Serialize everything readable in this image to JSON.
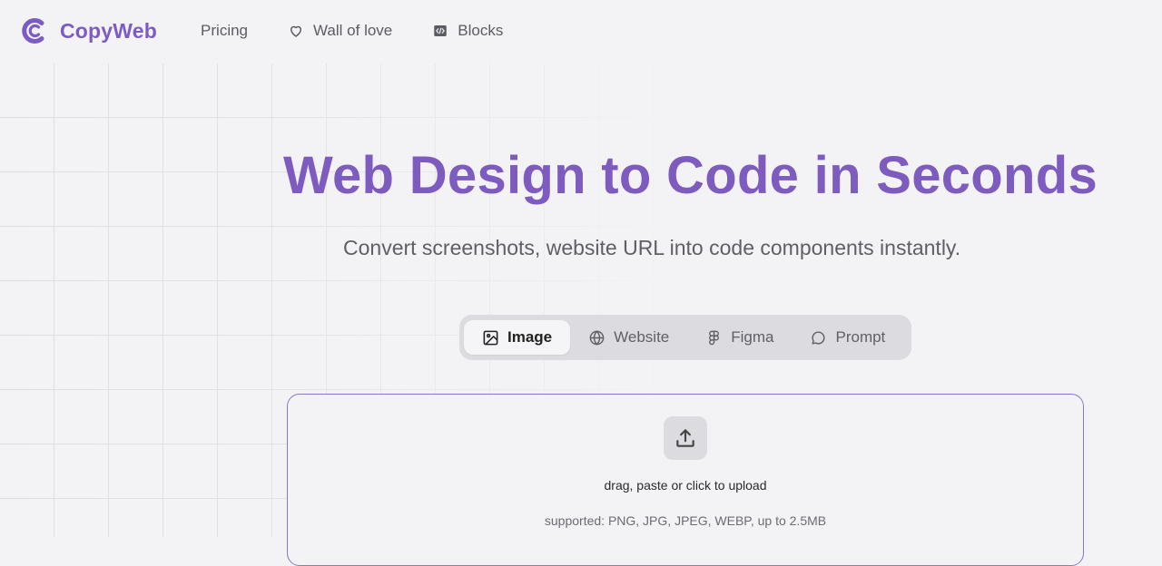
{
  "brand": {
    "name": "CopyWeb",
    "accent": "#7c5cc4"
  },
  "nav": {
    "items": [
      {
        "label": "Pricing",
        "icon": ""
      },
      {
        "label": "Wall of love",
        "icon": "heart-icon"
      },
      {
        "label": "Blocks",
        "icon": "code-block-icon"
      }
    ]
  },
  "hero": {
    "title": "Web Design to Code in Seconds",
    "subtitle": "Convert screenshots, website URL into code components instantly."
  },
  "tabs": [
    {
      "label": "Image",
      "icon": "image-icon",
      "active": true
    },
    {
      "label": "Website",
      "icon": "globe-icon",
      "active": false
    },
    {
      "label": "Figma",
      "icon": "figma-icon",
      "active": false
    },
    {
      "label": "Prompt",
      "icon": "chat-bubble-icon",
      "active": false
    }
  ],
  "upload": {
    "icon": "upload-icon",
    "instruction": "drag, paste or click to upload",
    "supported": "supported: PNG, JPG, JPEG, WEBP, up to 2.5MB"
  }
}
